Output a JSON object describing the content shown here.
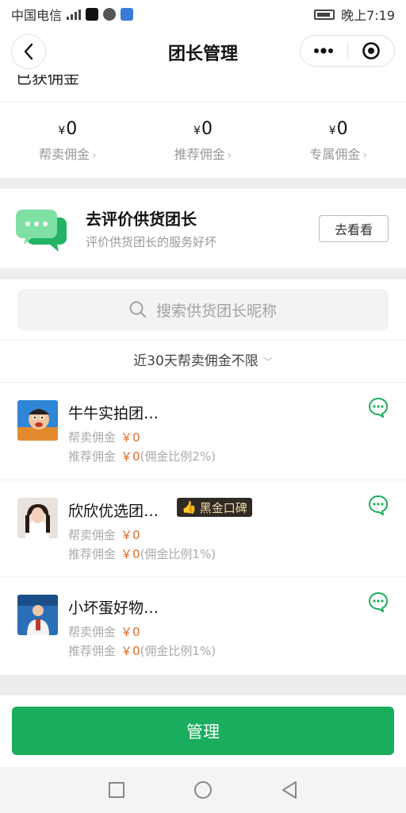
{
  "status_bar": {
    "carrier": "中国电信",
    "network": "4G",
    "time": "晚上7:19",
    "icons": [
      "signal-icon",
      "tiktok-icon",
      "app-icon",
      "browser-icon",
      "battery-icon"
    ]
  },
  "nav": {
    "title": "团长管理",
    "back_icon": "chevron-left-icon",
    "more_icon": "more-dots-icon",
    "close_icon": "target-close-icon"
  },
  "earnings": {
    "title": "已获佣金",
    "stats": [
      {
        "currency": "¥",
        "value": "0",
        "label": "帮卖佣金"
      },
      {
        "currency": "¥",
        "value": "0",
        "label": "推荐佣金"
      },
      {
        "currency": "¥",
        "value": "0",
        "label": "专属佣金"
      }
    ]
  },
  "review": {
    "title": "去评价供货团长",
    "subtitle": "评价供货团长的服务好坏",
    "button": "去看看"
  },
  "search": {
    "placeholder": "搜索供货团长昵称"
  },
  "filter": {
    "label": "近30天帮卖佣金不限"
  },
  "leaders": [
    {
      "name": "牛牛实拍团…",
      "badge": "",
      "sell_label": "帮卖佣金",
      "sell_amount": "￥0",
      "ref_label": "推荐佣金",
      "ref_amount": "￥0",
      "ref_ratio": "(佣金比例2%)"
    },
    {
      "name": "欣欣优选团…",
      "badge": "黑金口碑",
      "sell_label": "帮卖佣金",
      "sell_amount": "￥0",
      "ref_label": "推荐佣金",
      "ref_amount": "￥0",
      "ref_ratio": "(佣金比例1%)"
    },
    {
      "name": "小坏蛋好物…",
      "badge": "",
      "sell_label": "帮卖佣金",
      "sell_amount": "￥0",
      "ref_label": "推荐佣金",
      "ref_amount": "￥0",
      "ref_ratio": "(佣金比例1%)"
    }
  ],
  "bottom": {
    "manage": "管理"
  },
  "colors": {
    "brand_green": "#1aad5e",
    "amount_orange": "#e06a27",
    "badge_bg": "#2f2a24",
    "badge_text": "#f1d9a6"
  }
}
